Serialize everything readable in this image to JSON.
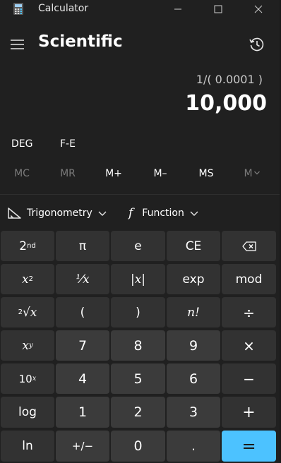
{
  "window": {
    "title": "Calculator",
    "minimize": "—",
    "maximize": "☐",
    "close": "✕"
  },
  "header": {
    "mode_title": "Scientific"
  },
  "display": {
    "expression": "1/( 0.0001 )",
    "value": "10,000"
  },
  "modes": {
    "angle": "DEG",
    "fe": "F-E"
  },
  "memory": [
    {
      "label": "MC",
      "enabled": false
    },
    {
      "label": "MR",
      "enabled": false
    },
    {
      "label": "M+",
      "enabled": true
    },
    {
      "label": "M–",
      "enabled": true
    },
    {
      "label": "MS",
      "enabled": true
    },
    {
      "label": "M",
      "enabled": false
    }
  ],
  "functions": {
    "trig_label": "Trigonometry",
    "func_label": "Function",
    "func_glyph": "f"
  },
  "keys": {
    "second": "2",
    "second_sup": "nd",
    "pi": "π",
    "e": "e",
    "ce": "CE",
    "x2_base": "x",
    "x2_sup": "2",
    "reciprocal": "⅟x",
    "abs": "|x|",
    "exp": "exp",
    "mod": "mod",
    "sqrt_index": "2",
    "sqrt_sym": "√x",
    "lparen": "(",
    "rparen": ")",
    "fact": "n!",
    "div": "÷",
    "xy_base": "x",
    "xy_sup": "y",
    "n7": "7",
    "n8": "8",
    "n9": "9",
    "mul": "×",
    "tenx_base": "10",
    "tenx_sup": "x",
    "n4": "4",
    "n5": "5",
    "n6": "6",
    "minus": "−",
    "log": "log",
    "n1": "1",
    "n2": "2",
    "n3": "3",
    "plus": "+",
    "ln": "ln",
    "negate": "+/−",
    "n0": "0",
    "dot": ".",
    "equals": "="
  },
  "colors": {
    "background": "#202020",
    "key_function": "#323232",
    "key_number": "#3b3b3b",
    "accent": "#4cc2ff"
  }
}
